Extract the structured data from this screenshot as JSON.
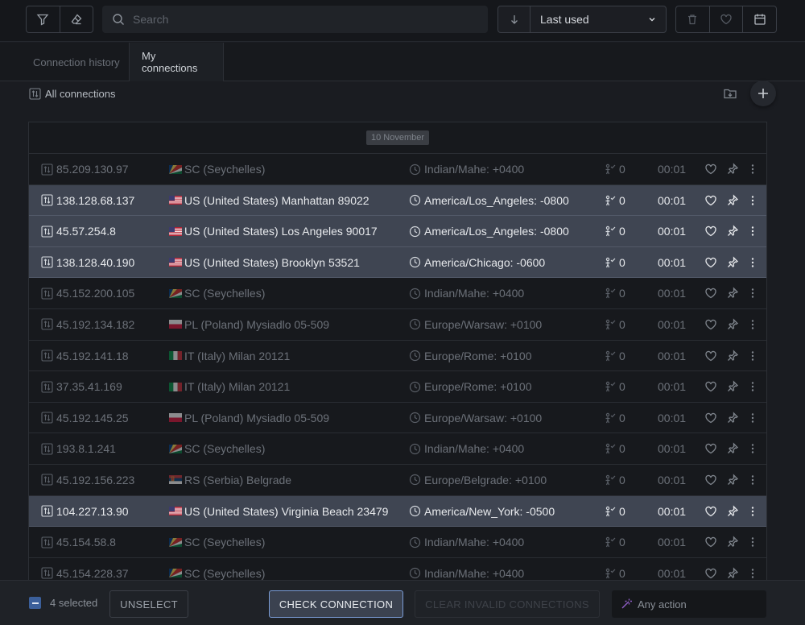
{
  "toolbar": {
    "search_placeholder": "Search",
    "sort_value": "Last used"
  },
  "tabs": [
    {
      "label": "Connection history"
    },
    {
      "label": "My connections"
    }
  ],
  "group": {
    "label": "All connections"
  },
  "date_header": "10 November",
  "rows": [
    {
      "ip": "85.209.130.97",
      "flag": "sc",
      "location": "SC (Seychelles)",
      "timezone": "Indian/Mahe: +0400",
      "count": "0",
      "time": "00:01",
      "selected": false
    },
    {
      "ip": "138.128.68.137",
      "flag": "us",
      "location": "US (United States) Manhattan 89022",
      "timezone": "America/Los_Angeles: -0800",
      "count": "0",
      "time": "00:01",
      "selected": true
    },
    {
      "ip": "45.57.254.8",
      "flag": "us",
      "location": "US (United States) Los Angeles 90017",
      "timezone": "America/Los_Angeles: -0800",
      "count": "0",
      "time": "00:01",
      "selected": true
    },
    {
      "ip": "138.128.40.190",
      "flag": "us",
      "location": "US (United States) Brooklyn 53521",
      "timezone": "America/Chicago: -0600",
      "count": "0",
      "time": "00:01",
      "selected": true
    },
    {
      "ip": "45.152.200.105",
      "flag": "sc",
      "location": "SC (Seychelles)",
      "timezone": "Indian/Mahe: +0400",
      "count": "0",
      "time": "00:01",
      "selected": false
    },
    {
      "ip": "45.192.134.182",
      "flag": "pl",
      "location": "PL (Poland) Mysiadlo 05-509",
      "timezone": "Europe/Warsaw: +0100",
      "count": "0",
      "time": "00:01",
      "selected": false
    },
    {
      "ip": "45.192.141.18",
      "flag": "it",
      "location": "IT (Italy) Milan 20121",
      "timezone": "Europe/Rome: +0100",
      "count": "0",
      "time": "00:01",
      "selected": false
    },
    {
      "ip": "37.35.41.169",
      "flag": "it",
      "location": "IT (Italy) Milan 20121",
      "timezone": "Europe/Rome: +0100",
      "count": "0",
      "time": "00:01",
      "selected": false
    },
    {
      "ip": "45.192.145.25",
      "flag": "pl",
      "location": "PL (Poland) Mysiadlo 05-509",
      "timezone": "Europe/Warsaw: +0100",
      "count": "0",
      "time": "00:01",
      "selected": false
    },
    {
      "ip": "193.8.1.241",
      "flag": "sc",
      "location": "SC (Seychelles)",
      "timezone": "Indian/Mahe: +0400",
      "count": "0",
      "time": "00:01",
      "selected": false
    },
    {
      "ip": "45.192.156.223",
      "flag": "rs",
      "location": "RS (Serbia) Belgrade",
      "timezone": "Europe/Belgrade: +0100",
      "count": "0",
      "time": "00:01",
      "selected": false
    },
    {
      "ip": "104.227.13.90",
      "flag": "us",
      "location": "US (United States) Virginia Beach 23479",
      "timezone": "America/New_York: -0500",
      "count": "0",
      "time": "00:01",
      "selected": true
    },
    {
      "ip": "45.154.58.8",
      "flag": "sc",
      "location": "SC (Seychelles)",
      "timezone": "Indian/Mahe: +0400",
      "count": "0",
      "time": "00:01",
      "selected": false
    },
    {
      "ip": "45.154.228.37",
      "flag": "sc",
      "location": "SC (Seychelles)",
      "timezone": "Indian/Mahe: +0400",
      "count": "0",
      "time": "00:01",
      "selected": false
    }
  ],
  "bottom": {
    "selected_count": "4 selected",
    "unselect_label": "UNSELECT",
    "check_label": "CHECK CONNECTION",
    "clear_label": "CLEAR INVALID CONNECTIONS",
    "any_action_label": "Any action"
  }
}
